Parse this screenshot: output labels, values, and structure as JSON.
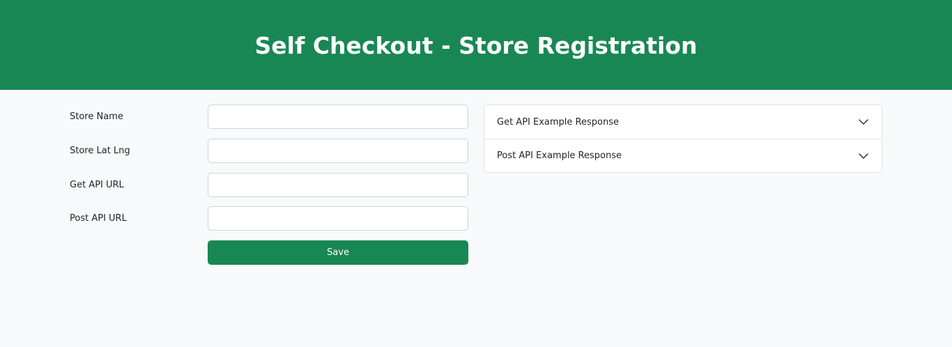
{
  "header": {
    "title": "Self Checkout - Store Registration"
  },
  "form": {
    "fields": [
      {
        "label": "Store Name",
        "value": "",
        "placeholder": ""
      },
      {
        "label": "Store Lat Lng",
        "value": "",
        "placeholder": ""
      },
      {
        "label": "Get API URL",
        "value": "",
        "placeholder": ""
      },
      {
        "label": "Post API URL",
        "value": "",
        "placeholder": ""
      }
    ],
    "save_label": "Save"
  },
  "accordion": {
    "items": [
      {
        "label": "Get API Example Response",
        "icon": "chevron-down-icon"
      },
      {
        "label": "Post API Example Response",
        "icon": "chevron-down-icon"
      }
    ]
  },
  "colors": {
    "brand": "#198754",
    "background": "#f8f9fa"
  }
}
